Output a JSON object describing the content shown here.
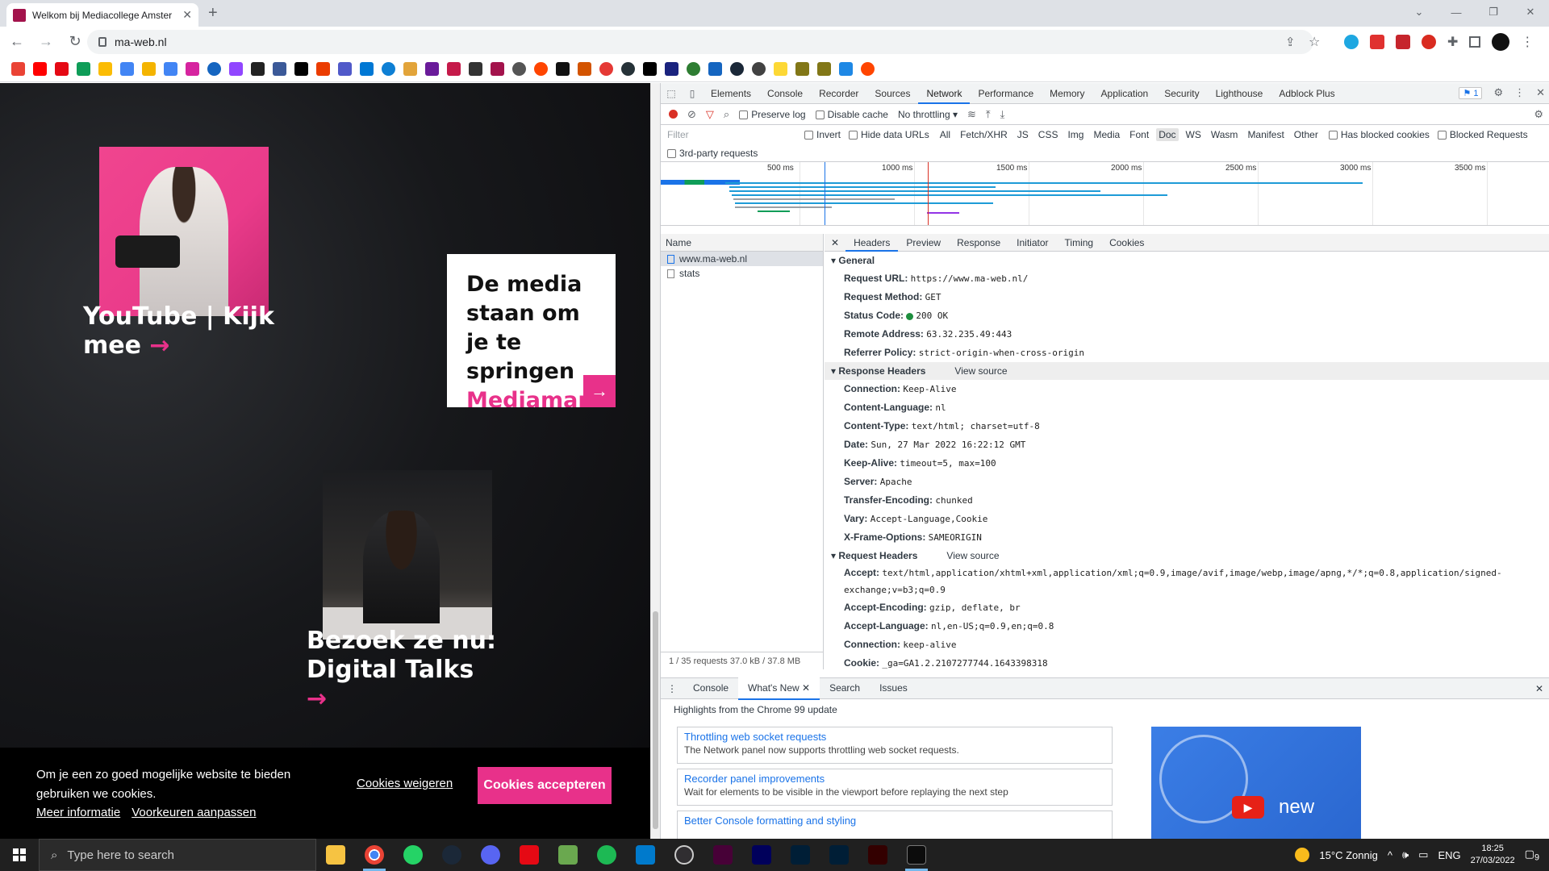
{
  "browser": {
    "tab_title": "Welkom bij Mediacollege Amster",
    "url": "ma-web.nl"
  },
  "site": {
    "card1_title": "YouTube | Kijk mee",
    "card2_title": "De media staan om je te springen",
    "card2_sub": "Mediamar",
    "card3_title": "Bezoek ze nu: Digital Talks",
    "arrow": "→",
    "cookie_text": "Om je een zo goed mogelijke website te bieden gebruiken we cookies.",
    "cookie_more": "Meer informatie",
    "cookie_prefs": "Voorkeuren aanpassen",
    "cookie_reject": "Cookies weigeren",
    "cookie_accept": "Cookies accepteren"
  },
  "devtools": {
    "tabs": [
      "Elements",
      "Console",
      "Recorder",
      "Sources",
      "Network",
      "Performance",
      "Memory",
      "Application",
      "Security",
      "Lighthouse",
      "Adblock Plus"
    ],
    "active_tab": "Network",
    "issues_count": "1",
    "preserve_log": "Preserve log",
    "disable_cache": "Disable cache",
    "throttling": "No throttling",
    "filter_placeholder": "Filter",
    "invert": "Invert",
    "hide_data_urls": "Hide data URLs",
    "filter_types": [
      "All",
      "Fetch/XHR",
      "JS",
      "CSS",
      "Img",
      "Media",
      "Font",
      "Doc",
      "WS",
      "Wasm",
      "Manifest",
      "Other"
    ],
    "active_filter": "Doc",
    "has_blocked_cookies": "Has blocked cookies",
    "blocked_requests": "Blocked Requests",
    "third_party": "3rd-party requests",
    "timeline_ticks": [
      "500 ms",
      "1000 ms",
      "1500 ms",
      "2000 ms",
      "2500 ms",
      "3000 ms",
      "3500 ms"
    ],
    "name_header": "Name",
    "requests": [
      "www.ma-web.nl",
      "stats"
    ],
    "footer": "1 / 35 requests   37.0 kB / 37.8 MB",
    "detail_tabs": [
      "Headers",
      "Preview",
      "Response",
      "Initiator",
      "Timing",
      "Cookies"
    ],
    "general_title": "General",
    "general": [
      {
        "k": "Request URL:",
        "v": "https://www.ma-web.nl/"
      },
      {
        "k": "Request Method:",
        "v": "GET"
      },
      {
        "k": "Status Code:",
        "v": "200 OK"
      },
      {
        "k": "Remote Address:",
        "v": "63.32.235.49:443"
      },
      {
        "k": "Referrer Policy:",
        "v": "strict-origin-when-cross-origin"
      }
    ],
    "response_title": "Response Headers",
    "view_source": "View source",
    "response": [
      {
        "k": "Connection:",
        "v": "Keep-Alive"
      },
      {
        "k": "Content-Language:",
        "v": "nl"
      },
      {
        "k": "Content-Type:",
        "v": "text/html; charset=utf-8"
      },
      {
        "k": "Date:",
        "v": "Sun, 27 Mar 2022 16:22:12 GMT"
      },
      {
        "k": "Keep-Alive:",
        "v": "timeout=5, max=100"
      },
      {
        "k": "Server:",
        "v": "Apache"
      },
      {
        "k": "Transfer-Encoding:",
        "v": "chunked"
      },
      {
        "k": "Vary:",
        "v": "Accept-Language,Cookie"
      },
      {
        "k": "X-Frame-Options:",
        "v": "SAMEORIGIN"
      }
    ],
    "request_title": "Request Headers",
    "request": [
      {
        "k": "Accept:",
        "v": "text/html,application/xhtml+xml,application/xml;q=0.9,image/avif,image/webp,image/apng,*/*;q=0.8,application/signed-exchange;v=b3;q=0.9"
      },
      {
        "k": "Accept-Encoding:",
        "v": "gzip, deflate, br"
      },
      {
        "k": "Accept-Language:",
        "v": "nl,en-US;q=0.9,en;q=0.8"
      },
      {
        "k": "Connection:",
        "v": "keep-alive"
      },
      {
        "k": "Cookie:",
        "v": "_ga=GA1.2.2107277744.1643398318"
      }
    ],
    "drawer_tabs": [
      "Console",
      "What's New",
      "Search",
      "Issues"
    ],
    "drawer_active": "What's New",
    "highlights": "Highlights from the Chrome 99 update",
    "news": [
      {
        "t": "Throttling web socket requests",
        "d": "The Network panel now supports throttling web socket requests."
      },
      {
        "t": "Recorder panel improvements",
        "d": "Wait for elements to be visible in the viewport before replaying the next step"
      },
      {
        "t": "Better Console formatting and styling",
        "d": ""
      }
    ],
    "video_text": "new"
  },
  "taskbar": {
    "search_placeholder": "Type here to search",
    "weather": "15°C  Zonnig",
    "lang": "ENG",
    "time": "18:25",
    "date": "27/03/2022",
    "notif_count": "9"
  },
  "colors": {
    "accent_pink": "#e8318a",
    "devtools_blue": "#1a73e8"
  }
}
